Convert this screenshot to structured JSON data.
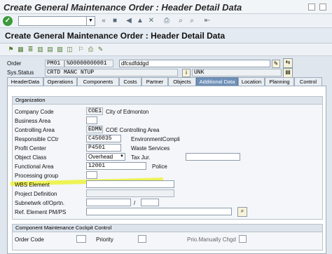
{
  "window": {
    "title": "Create General Maintenance Order : Header Detail Data"
  },
  "screen": {
    "title": "Create General Maintenance Order : Header Detail Data"
  },
  "header": {
    "order_label": "Order",
    "order_type": "PM01",
    "order_number": "%00000000001",
    "description": "dfcsdfddgd",
    "sys_status_label": "Sys.Status",
    "sys_status": "CRTD MANC NTUP",
    "user_status": "UNK"
  },
  "tabs": [
    "HeaderData",
    "Operations",
    "Components",
    "Costs",
    "Partner",
    "Objects",
    "Additional Data",
    "Location",
    "Planning",
    "Control"
  ],
  "active_tab": "Additional Data",
  "organization": {
    "group_title": "Organization",
    "company_code_label": "Company Code",
    "company_code": "COE1",
    "company_code_text": "City of Edmonton",
    "business_area_label": "Business Area",
    "business_area": "",
    "controlling_area_label": "Controlling Area",
    "controlling_area": "EDMN",
    "controlling_area_text": "COE Controlling Area",
    "resp_cctr_label": "Responsible CCtr",
    "resp_cctr": "C450035",
    "resp_cctr_text": "EnvironmentCompli",
    "profit_center_label": "Profit Center",
    "profit_center": "P4501",
    "profit_center_text": "Waste Services",
    "object_class_label": "Object Class",
    "object_class": "Overhead",
    "tax_jur_label": "Tax Jur.",
    "tax_jur": "",
    "functional_area_label": "Functional Area",
    "functional_area": "12001",
    "functional_area_text": "Police",
    "processing_group_label": "Processing group",
    "processing_group": "",
    "wbs_element_label": "WBS Element",
    "wbs_element": "",
    "project_definition_label": "Project Definition",
    "project_definition": "",
    "subnetwork_label": "Subnetwrk of/Oprtn.",
    "subnetwork": "",
    "subnetwork_sep": "/",
    "subnetwork_op": "",
    "ref_element_label": "Ref. Element PM/PS",
    "ref_element": ""
  },
  "cockpit": {
    "group_title": "Component Maintenance Cockpit Control",
    "order_code_label": "Order Code",
    "order_code": "",
    "priority_label": "Priority",
    "priority": "",
    "prio_manually_label": "Prio.Manually Chgd"
  },
  "colors": {
    "active_tab": "#6f90b8",
    "highlight": "#ecf23a",
    "ok_button": "#3a9a3a"
  }
}
